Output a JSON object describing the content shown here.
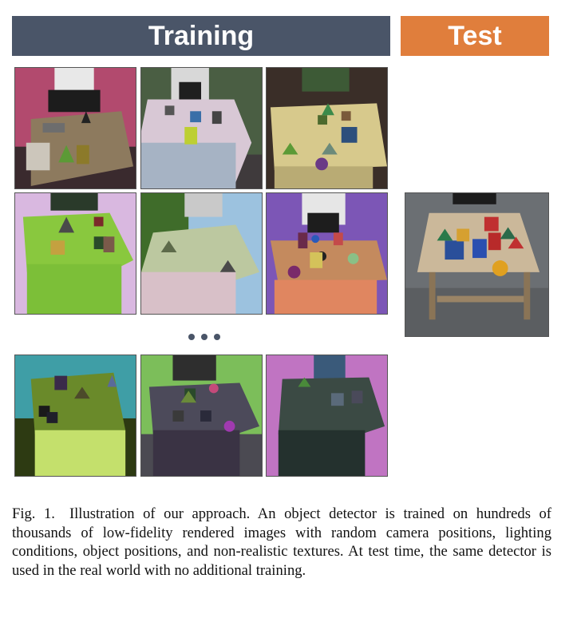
{
  "banners": {
    "training": "Training",
    "test": "Test"
  },
  "colors": {
    "training_banner": "#4a5568",
    "test_banner": "#e07e3c"
  },
  "training_images": [
    {
      "id": "r1c1",
      "description": "pink-wall scene, brown table, cylinders and cones"
    },
    {
      "id": "r1c2",
      "description": "green-wall scene, white table, small objects"
    },
    {
      "id": "r1c3",
      "description": "dark scene, yellow table, many objects"
    },
    {
      "id": "r2c1",
      "description": "lavender wall, green table"
    },
    {
      "id": "r2c2",
      "description": "green/blue wall, gray table"
    },
    {
      "id": "r2c3",
      "description": "purple wall, orange table, many objects"
    },
    {
      "id": "r3c1",
      "description": "teal wall, lime table"
    },
    {
      "id": "r3c2",
      "description": "green wall, dark purple table"
    },
    {
      "id": "r3c3",
      "description": "magenta wall, dark green table"
    }
  ],
  "test_image": {
    "description": "real-world wooden table with colored blocks"
  },
  "ellipsis": "•••",
  "caption": {
    "label": "Fig. 1.",
    "text": "Illustration of our approach. An object detector is trained on hundreds of thousands of low-fidelity rendered images with random camera positions, lighting conditions, object positions, and non-realistic textures. At test time, the same detector is used in the real world with no additional training."
  }
}
